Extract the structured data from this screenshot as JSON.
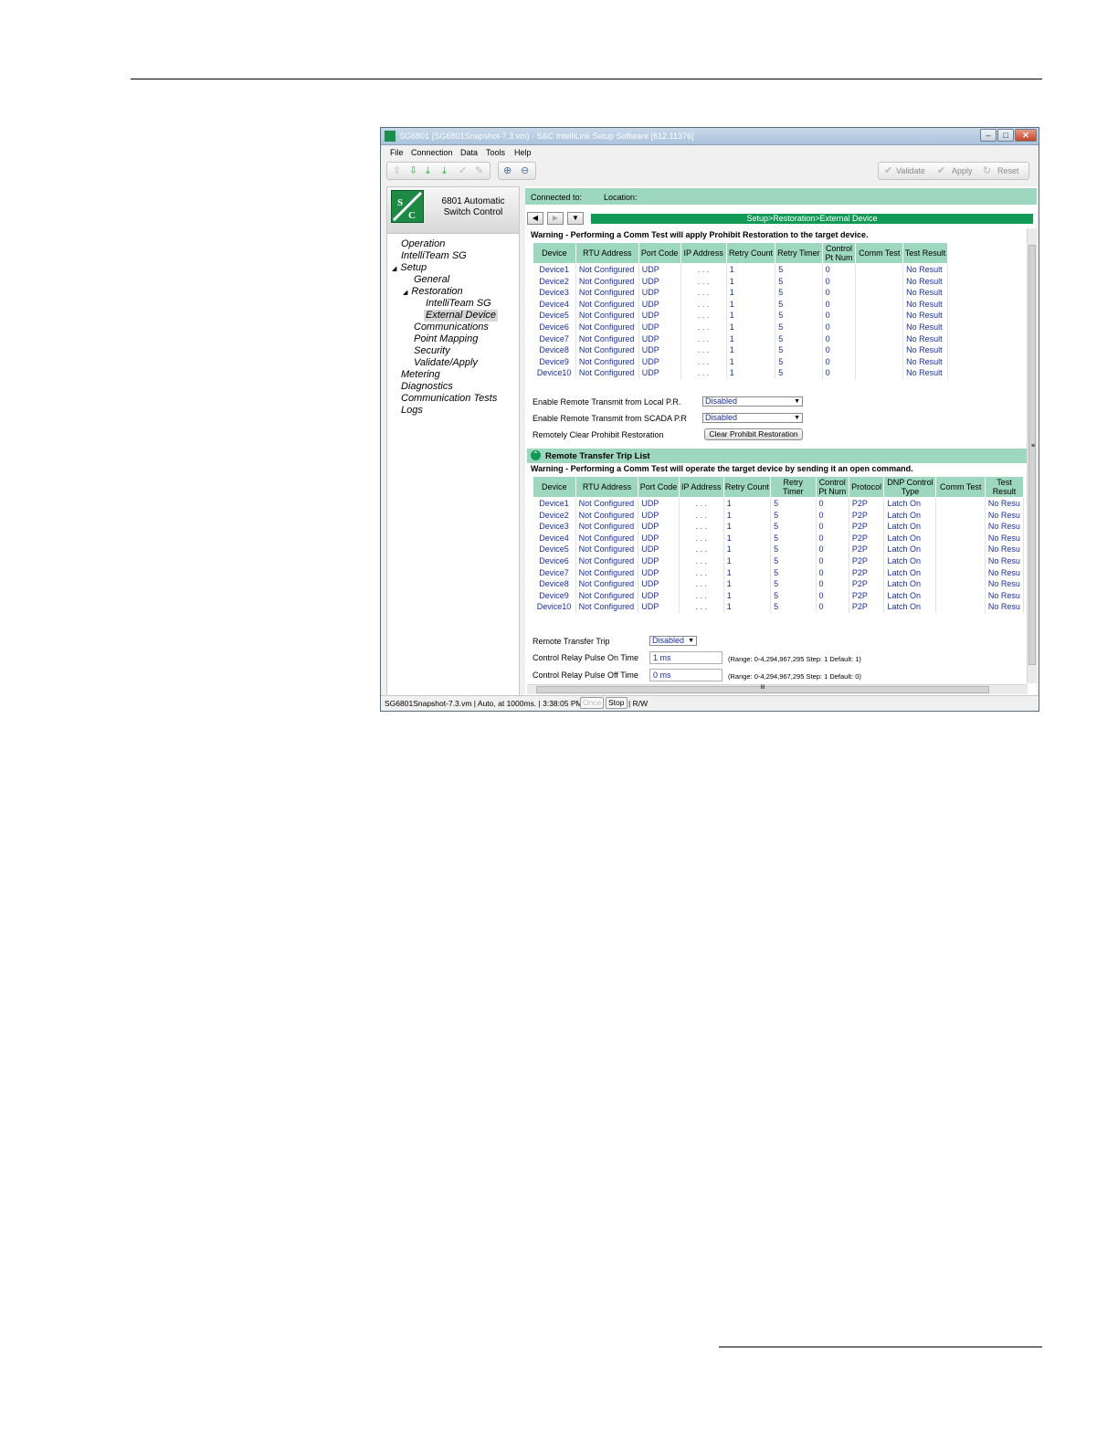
{
  "window": {
    "title": "SG6801 (SG6801Snapshot-7.3.vm) - S&C IntelliLink Setup Software [612.11376]",
    "minimize": "–",
    "maximize": "□",
    "close": "✕"
  },
  "menu": [
    "File",
    "Connection",
    "Data",
    "Tools",
    "Help"
  ],
  "toolbar": {
    "validate": "Validate",
    "apply": "Apply",
    "reset": "Reset"
  },
  "product": {
    "line1": "6801 Automatic",
    "line2": "Switch Control",
    "logo_text": "S&C"
  },
  "nav": {
    "operation": "Operation",
    "intelliteam": "IntelliTeam SG",
    "setup": "Setup",
    "general": "General",
    "restoration": "Restoration",
    "restoration_intelliteam": "IntelliTeam SG",
    "external_device": "External Device",
    "communications": "Communications",
    "point_mapping": "Point Mapping",
    "security": "Security",
    "validate_apply": "Validate/Apply",
    "metering": "Metering",
    "diagnostics": "Diagnostics",
    "communication_tests": "Communication Tests",
    "logs": "Logs"
  },
  "connection": {
    "connected_to": "Connected to:",
    "location": "Location:"
  },
  "breadcrumb": "Setup>Restoration>External Device",
  "section1": {
    "warning": "Warning - Performing a Comm Test will apply Prohibit Restoration to the target device.",
    "headers": [
      "Device",
      "RTU Address",
      "Port Code",
      "IP Address",
      "Retry Count",
      "Retry Timer",
      "Control Pt Num",
      "Comm Test",
      "Test Result"
    ],
    "rows": [
      [
        "Device1",
        "Not Configured",
        "UDP",
        ". . .",
        "1",
        "5",
        "0",
        "",
        "No Result"
      ],
      [
        "Device2",
        "Not Configured",
        "UDP",
        ". . .",
        "1",
        "5",
        "0",
        "",
        "No Result"
      ],
      [
        "Device3",
        "Not Configured",
        "UDP",
        ". . .",
        "1",
        "5",
        "0",
        "",
        "No Result"
      ],
      [
        "Device4",
        "Not Configured",
        "UDP",
        ". . .",
        "1",
        "5",
        "0",
        "",
        "No Result"
      ],
      [
        "Device5",
        "Not Configured",
        "UDP",
        ". . .",
        "1",
        "5",
        "0",
        "",
        "No Result"
      ],
      [
        "Device6",
        "Not Configured",
        "UDP",
        ". . .",
        "1",
        "5",
        "0",
        "",
        "No Result"
      ],
      [
        "Device7",
        "Not Configured",
        "UDP",
        ". . .",
        "1",
        "5",
        "0",
        "",
        "No Result"
      ],
      [
        "Device8",
        "Not Configured",
        "UDP",
        ". . .",
        "1",
        "5",
        "0",
        "",
        "No Result"
      ],
      [
        "Device9",
        "Not Configured",
        "UDP",
        ". . .",
        "1",
        "5",
        "0",
        "",
        "No Result"
      ],
      [
        "Device10",
        "Not Configured",
        "UDP",
        ". . .",
        "1",
        "5",
        "0",
        "",
        "No Result"
      ]
    ],
    "local_pr_label": "Enable Remote Transmit from Local P.R.",
    "local_pr_value": "Disabled",
    "scada_pr_label": "Enable Remote Transmit from SCADA P.R",
    "scada_pr_value": "Disabled",
    "clear_label": "Remotely Clear Prohibit Restoration",
    "clear_button": "Clear Prohibit Restoration"
  },
  "section2": {
    "title": "Remote Transfer Trip List",
    "warning": "Warning - Performing a Comm Test will operate the target device by sending it an open command.",
    "headers": [
      "Device",
      "RTU Address",
      "Port Code",
      "IP Address",
      "Retry Count",
      "Retry Timer",
      "Control Pt Num",
      "Protocol",
      "DNP Control Type",
      "Comm Test",
      "Test Result"
    ],
    "rows": [
      [
        "Device1",
        "Not Configured",
        "UDP",
        ". . .",
        "1",
        "5",
        "0",
        "P2P",
        "Latch On",
        "",
        "No Resu"
      ],
      [
        "Device2",
        "Not Configured",
        "UDP",
        ". . .",
        "1",
        "5",
        "0",
        "P2P",
        "Latch On",
        "",
        "No Resu"
      ],
      [
        "Device3",
        "Not Configured",
        "UDP",
        ". . .",
        "1",
        "5",
        "0",
        "P2P",
        "Latch On",
        "",
        "No Resu"
      ],
      [
        "Device4",
        "Not Configured",
        "UDP",
        ". . .",
        "1",
        "5",
        "0",
        "P2P",
        "Latch On",
        "",
        "No Resu"
      ],
      [
        "Device5",
        "Not Configured",
        "UDP",
        ". . .",
        "1",
        "5",
        "0",
        "P2P",
        "Latch On",
        "",
        "No Resu"
      ],
      [
        "Device6",
        "Not Configured",
        "UDP",
        ". . .",
        "1",
        "5",
        "0",
        "P2P",
        "Latch On",
        "",
        "No Resu"
      ],
      [
        "Device7",
        "Not Configured",
        "UDP",
        ". . .",
        "1",
        "5",
        "0",
        "P2P",
        "Latch On",
        "",
        "No Resu"
      ],
      [
        "Device8",
        "Not Configured",
        "UDP",
        ". . .",
        "1",
        "5",
        "0",
        "P2P",
        "Latch On",
        "",
        "No Resu"
      ],
      [
        "Device9",
        "Not Configured",
        "UDP",
        ". . .",
        "1",
        "5",
        "0",
        "P2P",
        "Latch On",
        "",
        "No Resu"
      ],
      [
        "Device10",
        "Not Configured",
        "UDP",
        ". . .",
        "1",
        "5",
        "0",
        "P2P",
        "Latch On",
        "",
        "No Resu"
      ]
    ],
    "rtt_label": "Remote Transfer Trip",
    "rtt_value": "Disabled",
    "on_label": "Control Relay Pulse On Time",
    "on_value": "1 ms",
    "on_range": "(Range: 0-4,294,967,295 Step: 1 Default: 1)",
    "off_label": "Control Relay Pulse Off Time",
    "off_value": "0 ms",
    "off_range": "(Range: 0-4,294,967,295 Step: 1 Default: 0)"
  },
  "scrollbar": {
    "grip": "≡",
    "hgrip": "III"
  },
  "statusbar": {
    "file": "SG6801Snapshot-7.3.vm | Auto, at 1000ms. | 3:38:05 PM",
    "once": "Once",
    "stop": "Stop",
    "mode": "| R/W"
  },
  "colors": {
    "header_teal": "#9ed7c0",
    "breadcrumb_green": "#119a55",
    "value_blue": "#1a2fa0"
  }
}
